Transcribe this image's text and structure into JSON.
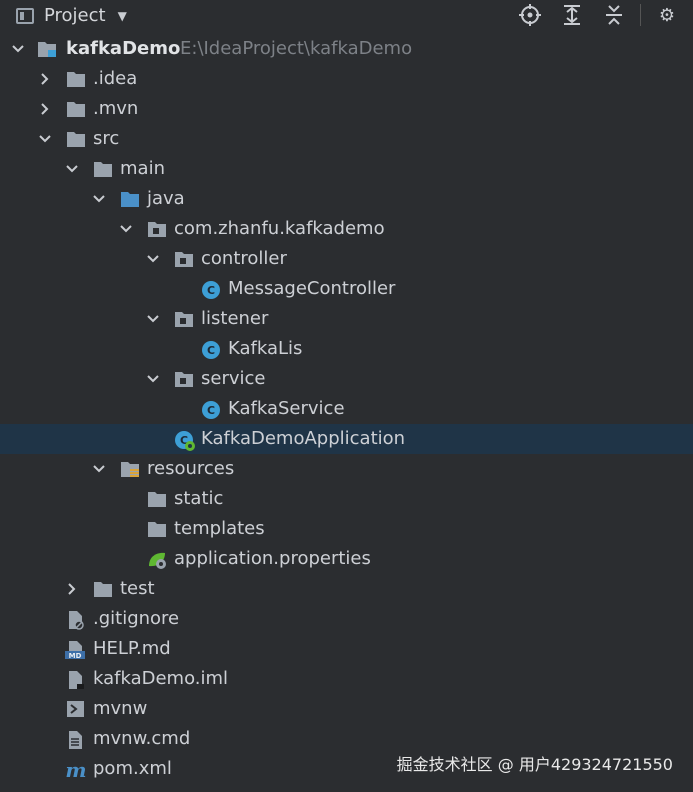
{
  "toolbar": {
    "title": "Project",
    "icons": [
      "project-view-icon",
      "dropdown-caret-icon",
      "locate-icon",
      "expand-all-icon",
      "collapse-all-icon",
      "settings-icon"
    ]
  },
  "tree": {
    "root_label": "kafkaDemo",
    "root_path": "E:\\IdeaProject\\kafkaDemo",
    "idea": ".idea",
    "mvn": ".mvn",
    "src": "src",
    "main": "main",
    "java": "java",
    "package": "com.zhanfu.kafkademo",
    "controller": "controller",
    "message_controller": "MessageController",
    "listener": "listener",
    "kafka_lis": "KafkaLis",
    "service": "service",
    "kafka_service": "KafkaService",
    "application_class": "KafkaDemoApplication",
    "resources": "resources",
    "static": "static",
    "templates": "templates",
    "properties": "application.properties",
    "test": "test",
    "gitignore": ".gitignore",
    "help": "HELP.md",
    "iml": "kafkaDemo.iml",
    "mvnw": "mvnw",
    "mvnw_cmd": "mvnw.cmd",
    "pom": "pom.xml"
  },
  "selected_item": "KafkaDemoApplication",
  "watermark": "掘金技术社区 @ 用户429324721550",
  "colors": {
    "background": "#2b2d30",
    "selection": "#1f3447",
    "folder": "#9aa3ad",
    "source_folder": "#4a90c8",
    "class_icon": "#3d9fd6",
    "spring_green": "#5fb832"
  }
}
